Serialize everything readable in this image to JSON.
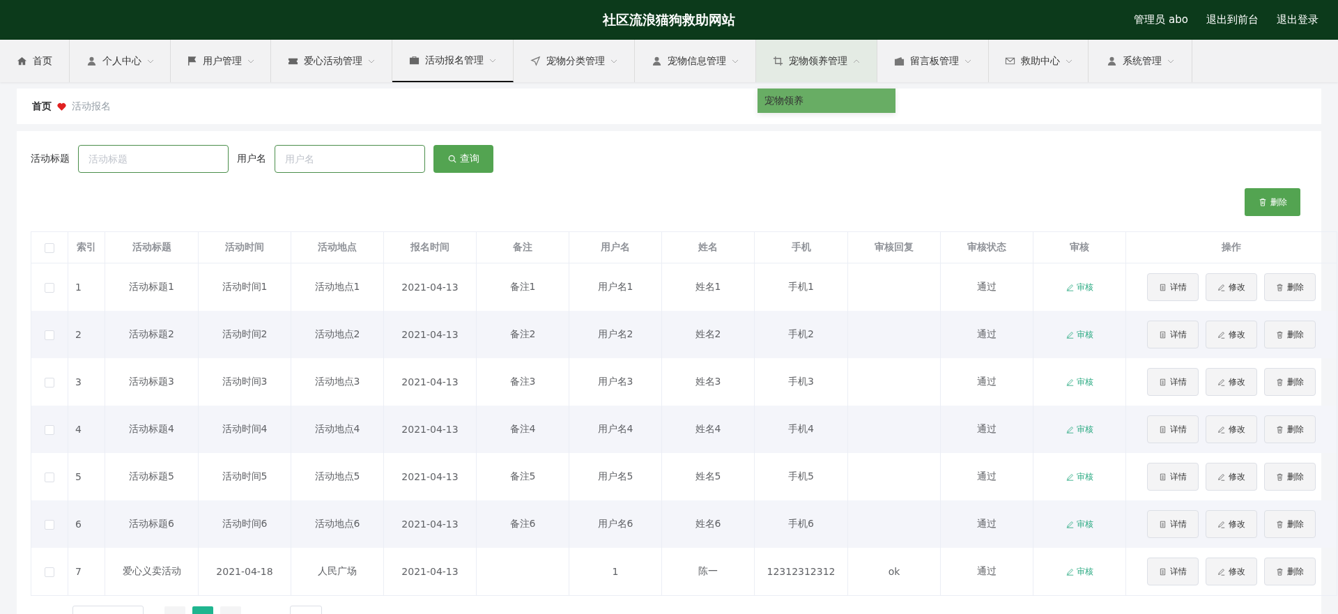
{
  "header": {
    "title": "社区流浪猫狗救助网站",
    "links": [
      {
        "label": "管理员 abo"
      },
      {
        "label": "退出到前台"
      },
      {
        "label": "退出登录"
      }
    ]
  },
  "nav": [
    {
      "label": "首页",
      "selected": false,
      "expanded": false,
      "caret": false
    },
    {
      "label": "个人中心",
      "selected": false,
      "expanded": false,
      "caret": true
    },
    {
      "label": "用户管理",
      "selected": false,
      "expanded": false,
      "caret": true
    },
    {
      "label": "爱心活动管理",
      "selected": false,
      "expanded": false,
      "caret": true
    },
    {
      "label": "活动报名管理",
      "selected": true,
      "expanded": false,
      "caret": true
    },
    {
      "label": "宠物分类管理",
      "selected": false,
      "expanded": false,
      "caret": true
    },
    {
      "label": "宠物信息管理",
      "selected": false,
      "expanded": false,
      "caret": true
    },
    {
      "label": "宠物领养管理",
      "selected": false,
      "expanded": true,
      "caret": true,
      "submenu": [
        {
          "label": "宠物领养",
          "selected": true
        }
      ]
    },
    {
      "label": "留言板管理",
      "selected": false,
      "expanded": false,
      "caret": true
    },
    {
      "label": "救助中心",
      "selected": false,
      "expanded": false,
      "caret": true
    },
    {
      "label": "系统管理",
      "selected": false,
      "expanded": false,
      "caret": true
    }
  ],
  "breadcrumb": {
    "home": "首页",
    "current": "活动报名"
  },
  "search": {
    "fields": [
      {
        "label": "活动标题",
        "placeholder": "活动标题"
      },
      {
        "label": "用户名",
        "placeholder": "用户名"
      }
    ],
    "button": "查询"
  },
  "delete_button": "删除",
  "table": {
    "all_checked": false,
    "columns": [
      {
        "label": "索引"
      },
      {
        "label": "活动标题"
      },
      {
        "label": "活动时间"
      },
      {
        "label": "活动地点"
      },
      {
        "label": "报名时间"
      },
      {
        "label": "备注"
      },
      {
        "label": "用户名"
      },
      {
        "label": "姓名"
      },
      {
        "label": "手机"
      },
      {
        "label": "审核回复"
      },
      {
        "label": "审核状态"
      },
      {
        "label": "审核"
      },
      {
        "label": "操作"
      }
    ],
    "rows": [
      {
        "checked": false,
        "index": "1",
        "title": "活动标题1",
        "time": "活动时间1",
        "place": "活动地点1",
        "signup": "2021-04-13",
        "note": "备注1",
        "username": "用户名1",
        "name": "姓名1",
        "phone": "手机1",
        "status": "通过",
        "audit": "审核",
        "ops": [
          "详情",
          "修改",
          "删除"
        ]
      },
      {
        "checked": false,
        "index": "2",
        "title": "活动标题2",
        "time": "活动时间2",
        "place": "活动地点2",
        "signup": "2021-04-13",
        "note": "备注2",
        "username": "用户名2",
        "name": "姓名2",
        "phone": "手机2",
        "status": "通过",
        "audit": "审核",
        "ops": [
          "详情",
          "修改",
          "删除"
        ]
      },
      {
        "checked": false,
        "index": "3",
        "title": "活动标题3",
        "time": "活动时间3",
        "place": "活动地点3",
        "signup": "2021-04-13",
        "note": "备注3",
        "username": "用户名3",
        "name": "姓名3",
        "phone": "手机3",
        "status": "通过",
        "audit": "审核",
        "ops": [
          "详情",
          "修改",
          "删除"
        ]
      },
      {
        "checked": false,
        "index": "4",
        "title": "活动标题4",
        "time": "活动时间4",
        "place": "活动地点4",
        "signup": "2021-04-13",
        "note": "备注4",
        "username": "用户名4",
        "name": "姓名4",
        "phone": "手机4",
        "status": "通过",
        "audit": "审核",
        "ops": [
          "详情",
          "修改",
          "删除"
        ]
      },
      {
        "checked": false,
        "index": "5",
        "title": "活动标题5",
        "time": "活动时间5",
        "place": "活动地点5",
        "signup": "2021-04-13",
        "note": "备注5",
        "username": "用户名5",
        "name": "姓名5",
        "phone": "手机5",
        "status": "通过",
        "audit": "审核",
        "ops": [
          "详情",
          "修改",
          "删除"
        ]
      },
      {
        "checked": false,
        "index": "6",
        "title": "活动标题6",
        "time": "活动时间6",
        "place": "活动地点6",
        "signup": "2021-04-13",
        "note": "备注6",
        "username": "用户名6",
        "name": "姓名6",
        "phone": "手机6",
        "status": "通过",
        "audit": "审核",
        "ops": [
          "详情",
          "修改",
          "删除"
        ]
      },
      {
        "checked": false,
        "index": "7",
        "title": "爱心义卖活动",
        "time": "2021-04-18",
        "place": "人民广场",
        "signup": "2021-04-13",
        "username": "1",
        "name": "陈一",
        "phone": "12312312312",
        "reply": "ok",
        "status": "通过",
        "audit": "审核",
        "ops": [
          "详情",
          "修改",
          "删除"
        ]
      }
    ]
  },
  "pagination": {
    "pages": [
      {
        "selected": false
      },
      {
        "selected": true
      },
      {
        "selected": false
      }
    ]
  }
}
